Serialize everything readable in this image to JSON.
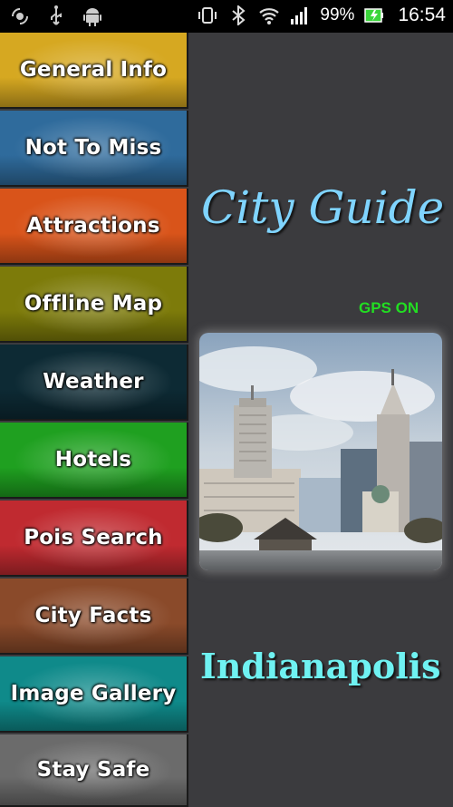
{
  "status_bar": {
    "left_icons": [
      "gps-status-icon",
      "usb-icon",
      "android-icon"
    ],
    "right_icons": [
      "vibrate-icon",
      "bluetooth-icon",
      "wifi-icon",
      "signal-icon"
    ],
    "battery_percent": "99%",
    "time": "16:54"
  },
  "menu": {
    "items": [
      {
        "label": "General Info",
        "color": "#d6a821"
      },
      {
        "label": "Not To Miss",
        "color": "#2f6b9c"
      },
      {
        "label": "Attractions",
        "color": "#d9541a"
      },
      {
        "label": "Offline Map",
        "color": "#7d7b0a"
      },
      {
        "label": "Weather",
        "color": "#0d2a34"
      },
      {
        "label": "Hotels",
        "color": "#1fa020"
      },
      {
        "label": "Pois Search",
        "color": "#c02a30"
      },
      {
        "label": "City Facts",
        "color": "#8a4a2a"
      },
      {
        "label": "Image Gallery",
        "color": "#0f8a8a"
      },
      {
        "label": "Stay Safe",
        "color": "#6b6b6b"
      }
    ]
  },
  "main": {
    "title": "City Guide",
    "gps_status": "GPS ON",
    "city_name": "Indianapolis",
    "photo_icon": "city-skyline-photo"
  }
}
